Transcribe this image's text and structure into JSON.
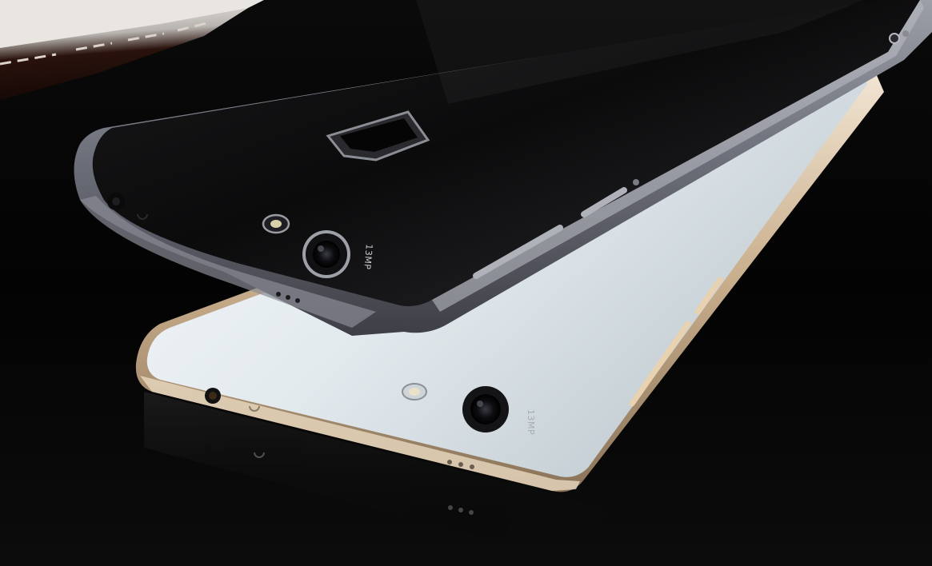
{
  "scene": {
    "description_free": true,
    "colors": {
      "background": "#020202",
      "black_phone_back": "#0b0b0c",
      "black_phone_frame": "#6e6f7a",
      "white_phone_back": "#dfe6ea",
      "white_phone_frame": "#cdb69a",
      "leather": "#3a1a12",
      "stitching": "#d8d0c8"
    },
    "black_phone": {
      "camera_text": "13MP"
    },
    "white_phone": {
      "camera_text": "13MP"
    }
  }
}
